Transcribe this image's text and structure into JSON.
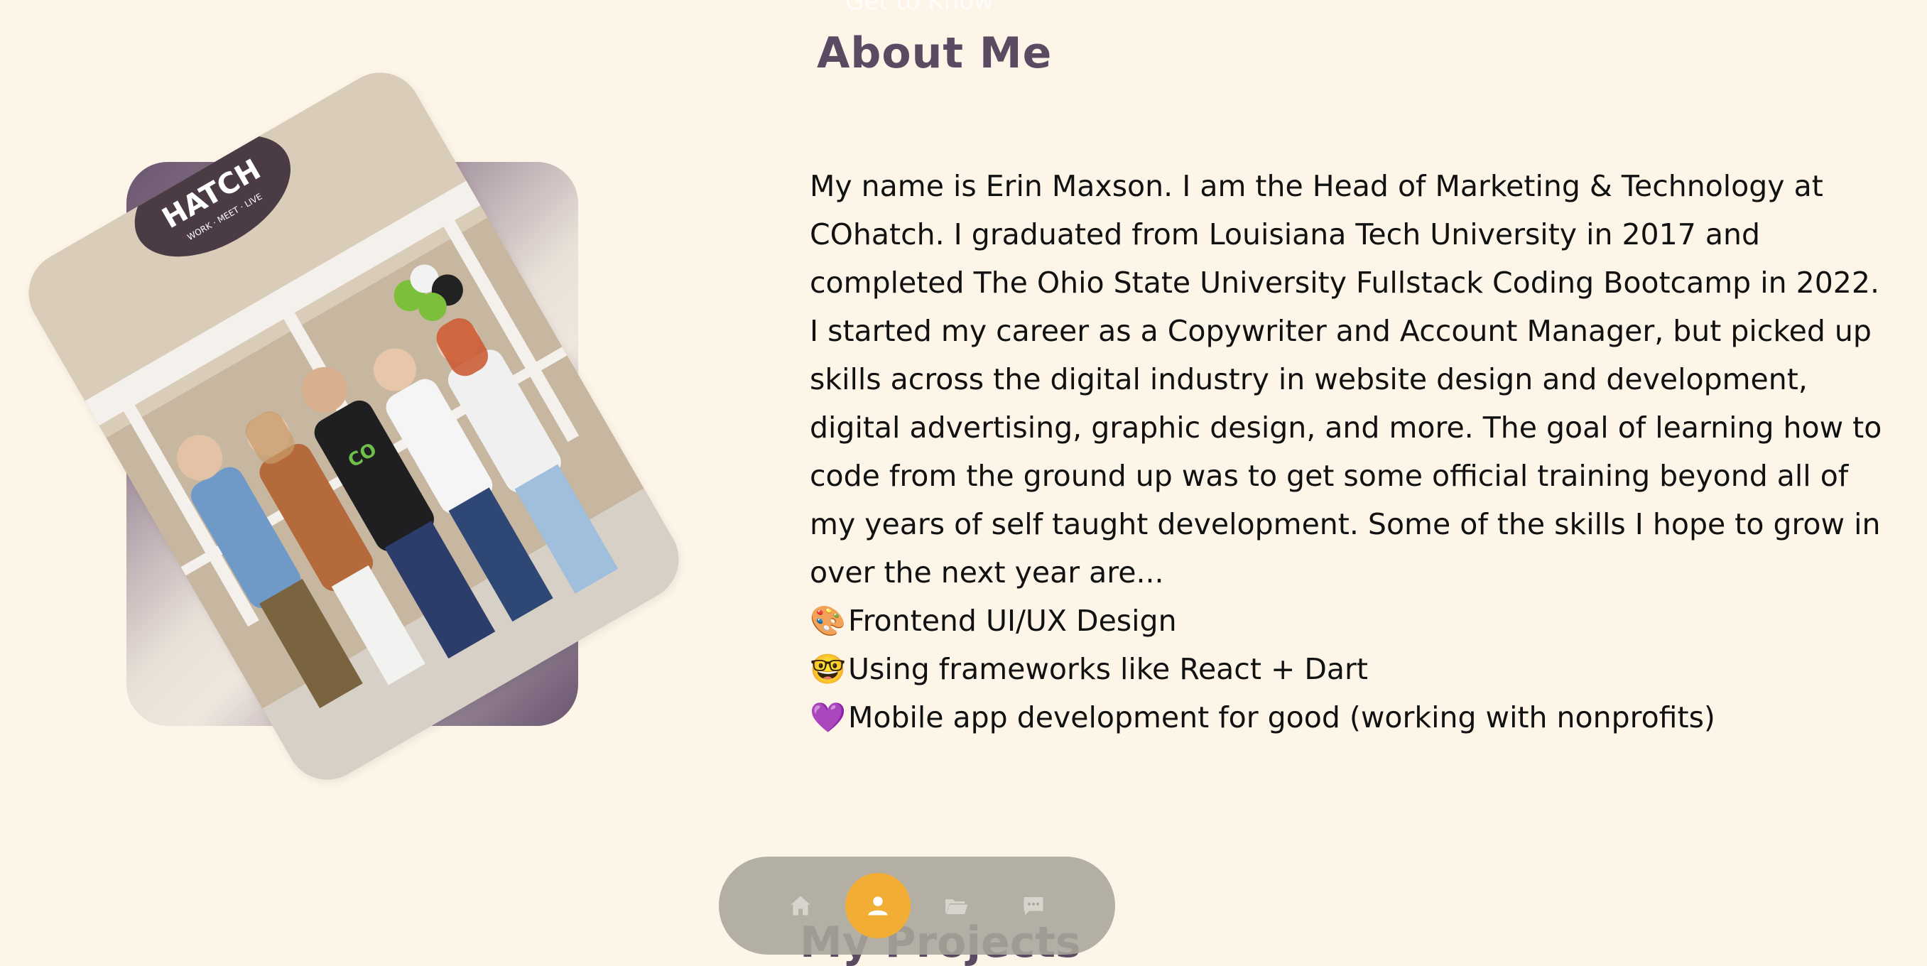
{
  "header": {
    "eyebrow": "Get to Know",
    "title": "About Me"
  },
  "photo": {
    "alt": "Group photo of five people in front of a porch with a HATCH sign",
    "sign_text": "HATCH",
    "sign_subtext": "WORK · MEET · LIVE"
  },
  "bio": {
    "paragraph": "My name is Erin Maxson. I am the Head of Marketing & Technology at COhatch. I graduated from Louisiana Tech University in 2017 and completed The Ohio State University Fullstack Coding Bootcamp in 2022. I started my career as a Copywriter and Account Manager, but picked up skills across the digital industry in website design and development, digital advertising, graphic design, and more. The goal of learning how to code from the ground up was to get some official training beyond all of my years of self taught development. Some of the skills I hope to grow in over the next year are...",
    "items": [
      {
        "emoji": "🎨",
        "text": "Frontend UI/UX Design"
      },
      {
        "emoji": "🤓",
        "text": "Using frameworks like React + Dart"
      },
      {
        "emoji": "💜",
        "text": "Mobile app development for good (working with nonprofits)"
      }
    ]
  },
  "next_section": {
    "title": "My Projects"
  },
  "nav": {
    "items": [
      {
        "icon": "home-icon",
        "active": false
      },
      {
        "icon": "user-icon",
        "active": true
      },
      {
        "icon": "folder-icon",
        "active": false
      },
      {
        "icon": "chat-icon",
        "active": false
      }
    ],
    "colors": {
      "active_bg": "#f2ad35",
      "icon": "#d8d4cc",
      "active_icon": "#ffffff"
    }
  },
  "colors": {
    "background": "#fdf6e8",
    "heading": "#5b4a62",
    "accent": "#f2ad35"
  }
}
